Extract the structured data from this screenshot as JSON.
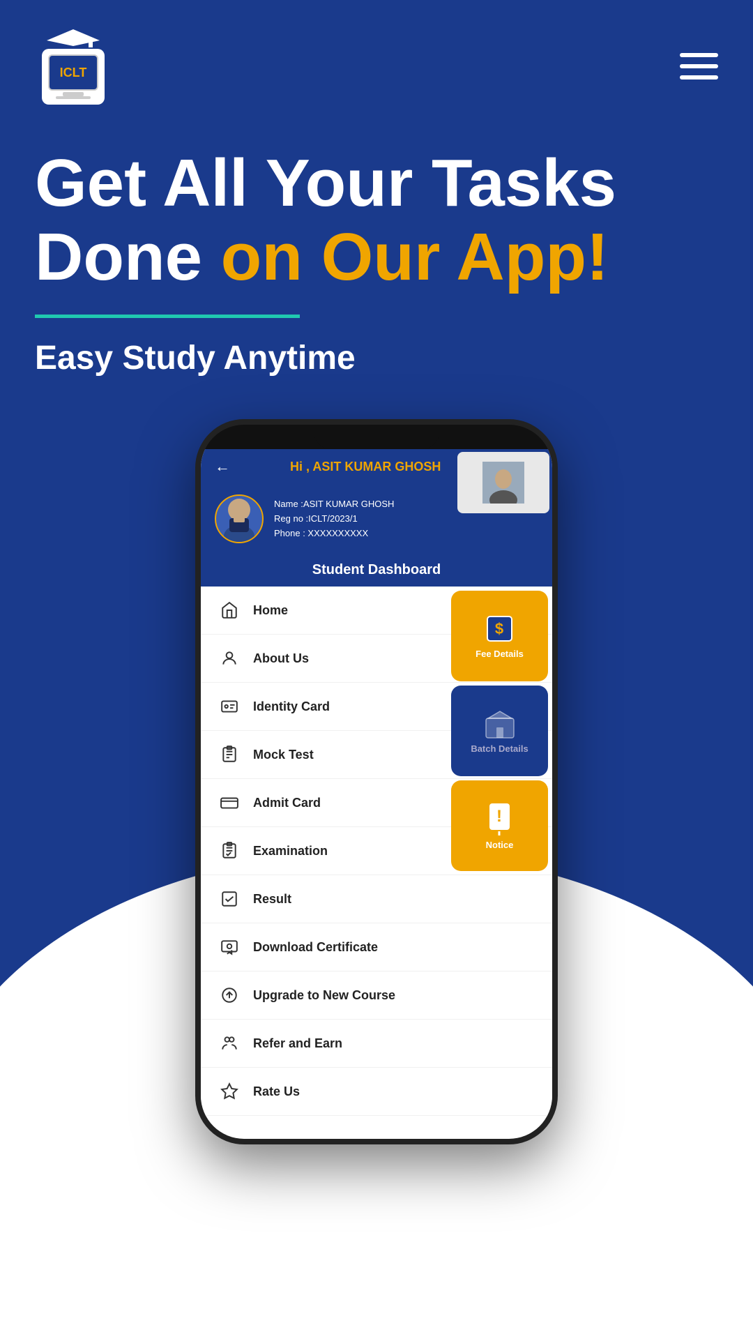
{
  "app": {
    "name": "ICLT",
    "tagline_line1": "Get All Your Tasks",
    "tagline_line2_normal": "Done ",
    "tagline_line2_highlight": "on Our App!",
    "subtitle": "Easy Study Anytime"
  },
  "header": {
    "logo_text": "ICLT",
    "menu_label": "menu"
  },
  "phone": {
    "greeting": "Hi , ASIT KUMAR GHOSH",
    "student": {
      "name": "Name :ASIT KUMAR GHOSH",
      "reg": "Reg no :ICLT/2023/1",
      "phone": "Phone : XXXXXXXXXX"
    },
    "dashboard_title": "Student Dashboard",
    "menu_items": [
      {
        "id": "home",
        "label": "Home",
        "icon": "home"
      },
      {
        "id": "about",
        "label": "About Us",
        "icon": "user"
      },
      {
        "id": "identity",
        "label": "Identity Card",
        "icon": "id-card"
      },
      {
        "id": "mock",
        "label": "Mock Test",
        "icon": "clipboard"
      },
      {
        "id": "admit",
        "label": "Admit Card",
        "icon": "card"
      },
      {
        "id": "exam",
        "label": "Examination",
        "icon": "exam"
      },
      {
        "id": "result",
        "label": "Result",
        "icon": "chart"
      },
      {
        "id": "certificate",
        "label": "Download Certificate",
        "icon": "certificate"
      },
      {
        "id": "upgrade",
        "label": "Upgrade to New Course",
        "icon": "upgrade"
      },
      {
        "id": "refer",
        "label": "Refer and Earn",
        "icon": "refer"
      },
      {
        "id": "rate",
        "label": "Rate Us",
        "icon": "star"
      }
    ],
    "side_cards": [
      {
        "label": "Fee Details",
        "icon": "$",
        "style": "yellow"
      },
      {
        "label": "Batch Details",
        "icon": "🏠",
        "style": "blue"
      },
      {
        "label": "Notice",
        "icon": "!",
        "style": "yellow"
      }
    ]
  }
}
